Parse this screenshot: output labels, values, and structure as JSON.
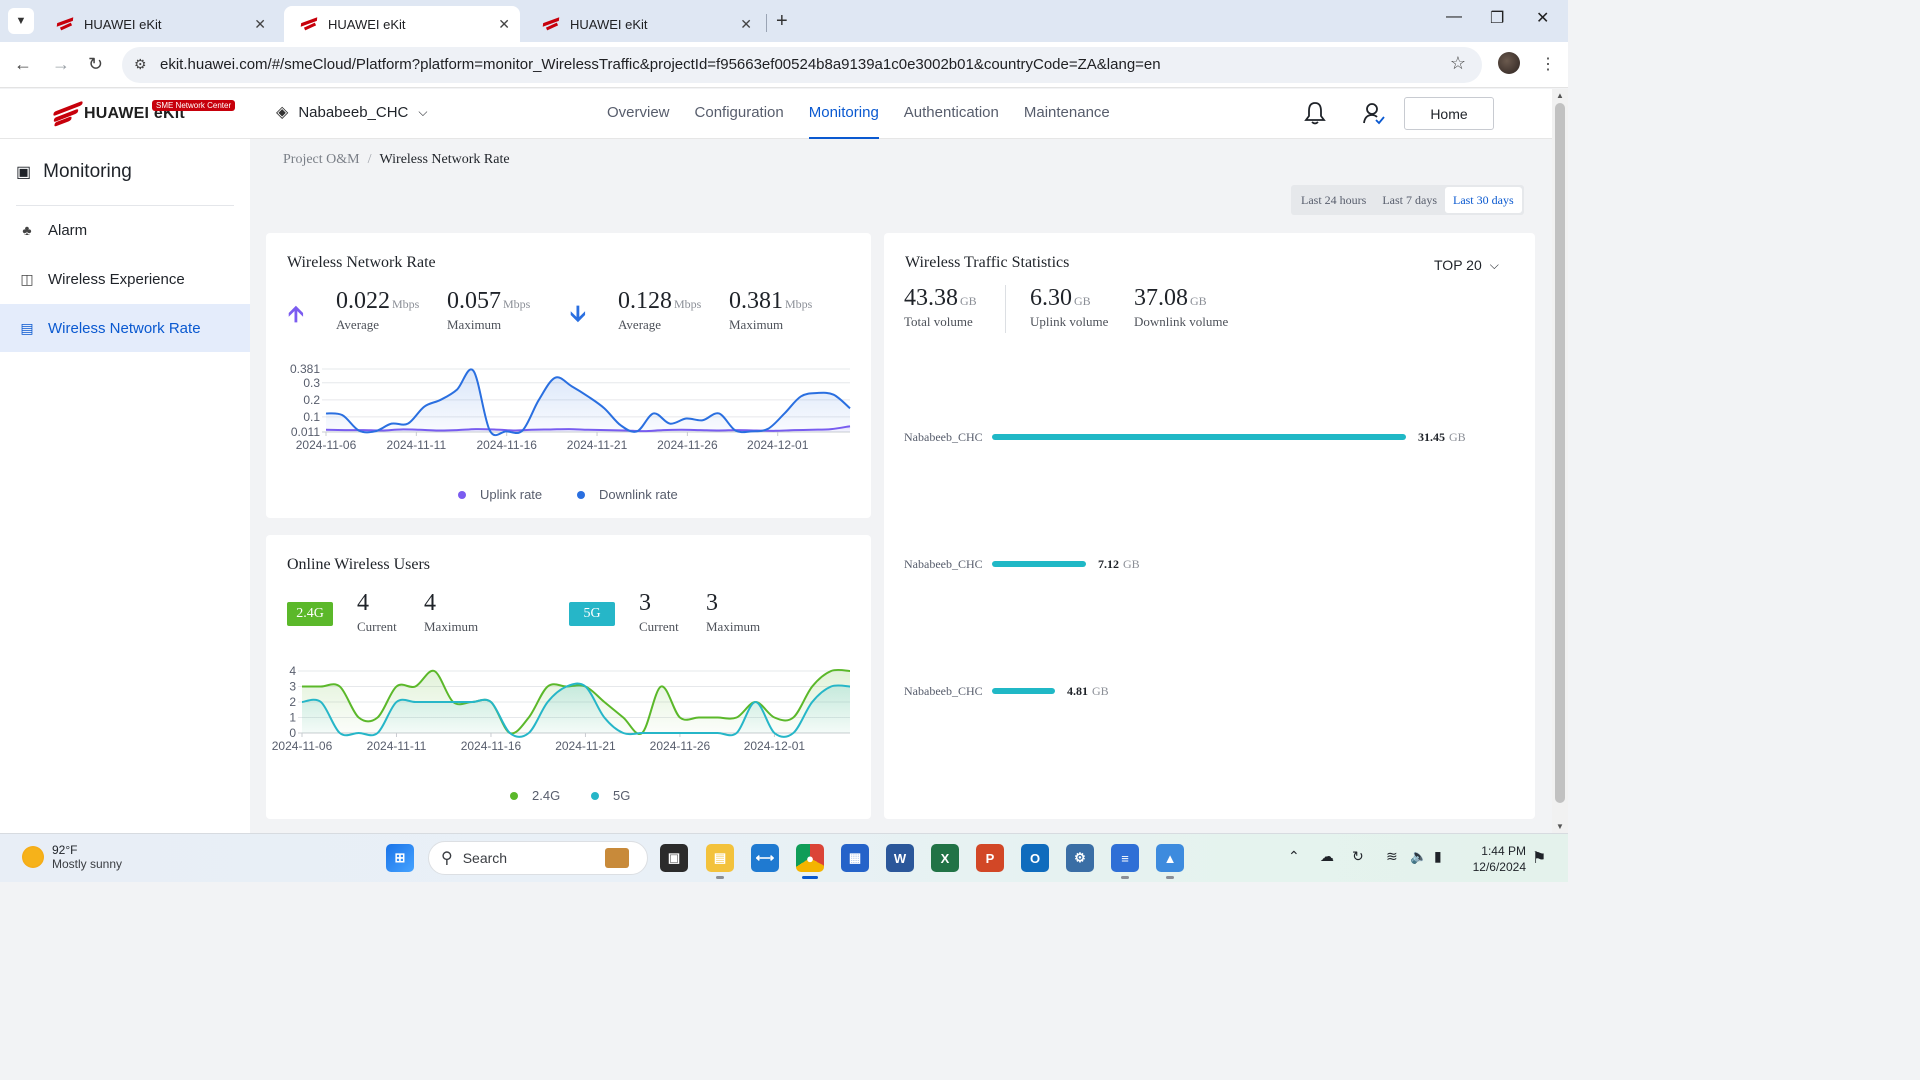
{
  "browser": {
    "tabs": [
      {
        "title": "HUAWEI eKit",
        "active": false
      },
      {
        "title": "HUAWEI eKit",
        "active": true
      },
      {
        "title": "HUAWEI eKit",
        "active": false
      }
    ],
    "url": "ekit.huawei.com/#/smeCloud/Platform?platform=monitor_WirelessTraffic&projectId=f95663ef00524b8a9139a1c0e3002b01&countryCode=ZA&lang=en"
  },
  "header": {
    "brand": "HUAWEI eKit",
    "badge": "SME Network Center",
    "project": "Nababeeb_CHC",
    "nav": [
      "Overview",
      "Configuration",
      "Monitoring",
      "Authentication",
      "Maintenance"
    ],
    "active_nav": "Monitoring",
    "home_label": "Home"
  },
  "sidebar": {
    "title": "Monitoring",
    "items": [
      {
        "label": "Alarm",
        "icon": "bell-icon",
        "active": false
      },
      {
        "label": "Wireless Experience",
        "icon": "monitor-wifi-icon",
        "active": false
      },
      {
        "label": "Wireless Network Rate",
        "icon": "chart-icon",
        "active": true
      }
    ]
  },
  "breadcrumb": {
    "parent": "Project O&M",
    "current": "Wireless Network Rate"
  },
  "time_range": {
    "options": [
      "Last 24 hours",
      "Last 7 days",
      "Last 30 days"
    ],
    "selected": "Last 30 days"
  },
  "rate_card": {
    "title": "Wireless Network Rate",
    "uplink": {
      "average": "0.022",
      "maximum": "0.057"
    },
    "downlink": {
      "average": "0.128",
      "maximum": "0.381"
    },
    "unit": "Mbps",
    "average_label": "Average",
    "maximum_label": "Maximum"
  },
  "users_card": {
    "title": "Online Wireless Users",
    "band24": {
      "tag": "2.4G",
      "current": "4",
      "maximum": "4"
    },
    "band5": {
      "tag": "5G",
      "current": "3",
      "maximum": "3"
    },
    "current_label": "Current",
    "maximum_label": "Maximum"
  },
  "traffic_card": {
    "title": "Wireless Traffic Statistics",
    "top_select": "TOP 20",
    "total": {
      "value": "43.38",
      "unit": "GB",
      "label": "Total volume"
    },
    "uplink": {
      "value": "6.30",
      "unit": "GB",
      "label": "Uplink volume"
    },
    "downlink": {
      "value": "37.08",
      "unit": "GB",
      "label": "Downlink volume"
    },
    "rows": [
      {
        "name": "Nababeeb_CHC",
        "value": 31.45,
        "value_text": "31.45",
        "unit": "GB"
      },
      {
        "name": "Nababeeb_CHC",
        "value": 7.12,
        "value_text": "7.12",
        "unit": "GB"
      },
      {
        "name": "Nababeeb_CHC",
        "value": 4.81,
        "value_text": "4.81",
        "unit": "GB"
      }
    ]
  },
  "colors": {
    "primary": "#0a59d0",
    "uplink": "#7b5cf0",
    "downlink": "#2a6fe0",
    "band24": "#5bb82a",
    "band5": "#26b6c8",
    "traffic_bar": "#20b8c6"
  },
  "chart_data": [
    {
      "type": "line",
      "title": "Wireless Network Rate",
      "ytick_labels": [
        "0.011",
        "0.1",
        "0.2",
        "0.3",
        "0.381"
      ],
      "yticks": [
        0.011,
        0.1,
        0.2,
        0.3,
        0.381
      ],
      "ylim": [
        0.011,
        0.381
      ],
      "x_tick_labels": [
        "2024-11-06",
        "2024-11-11",
        "2024-11-16",
        "2024-11-21",
        "2024-11-26",
        "2024-12-01"
      ],
      "x_tick_index": [
        0,
        5,
        10,
        15,
        20,
        25
      ],
      "series": [
        {
          "name": "Uplink rate",
          "color": "#7b5cf0",
          "values": [
            0.024,
            0.022,
            0.022,
            0.02,
            0.026,
            0.024,
            0.02,
            0.022,
            0.028,
            0.026,
            0.02,
            0.024,
            0.026,
            0.028,
            0.024,
            0.022,
            0.02,
            0.016,
            0.022,
            0.024,
            0.022,
            0.02,
            0.022,
            0.02,
            0.018,
            0.022,
            0.024,
            0.028,
            0.045
          ]
        },
        {
          "name": "Downlink rate",
          "color": "#2a6fe0",
          "values": [
            0.12,
            0.11,
            0.02,
            0.015,
            0.06,
            0.06,
            0.16,
            0.2,
            0.26,
            0.371,
            0.02,
            0.015,
            0.02,
            0.2,
            0.33,
            0.28,
            0.22,
            0.15,
            0.05,
            0.015,
            0.12,
            0.06,
            0.09,
            0.08,
            0.12,
            0.02,
            0.015,
            0.03,
            0.12,
            0.22,
            0.24,
            0.23,
            0.15
          ]
        }
      ],
      "legend": "bottom"
    },
    {
      "type": "line",
      "title": "Online Wireless Users",
      "yticks": [
        0,
        1,
        2,
        3,
        4
      ],
      "ylim": [
        0,
        4
      ],
      "x_tick_labels": [
        "2024-11-06",
        "2024-11-11",
        "2024-11-16",
        "2024-11-21",
        "2024-11-26",
        "2024-12-01"
      ],
      "x_tick_index": [
        0,
        5,
        10,
        15,
        20,
        25
      ],
      "series": [
        {
          "name": "2.4G",
          "color": "#5bb82a",
          "values": [
            3,
            3,
            3,
            1,
            1,
            3,
            3,
            4,
            2,
            2,
            2,
            0,
            1,
            3,
            3,
            3,
            2,
            1,
            0,
            3,
            1,
            1,
            1,
            1,
            2,
            1,
            1,
            3,
            4,
            4
          ]
        },
        {
          "name": "5G",
          "color": "#26b6c8",
          "values": [
            2,
            2,
            0,
            0,
            0,
            2,
            2,
            2,
            2,
            2,
            2,
            0,
            0,
            2,
            3,
            3,
            1,
            0,
            0,
            0,
            0,
            0,
            0,
            0,
            2,
            0,
            0,
            2,
            3,
            3
          ]
        }
      ],
      "legend": "bottom"
    },
    {
      "type": "bar",
      "title": "Wireless Traffic Statistics",
      "orientation": "horizontal",
      "categories": [
        "Nababeeb_CHC",
        "Nababeeb_CHC",
        "Nababeeb_CHC"
      ],
      "values": [
        31.45,
        7.12,
        4.81
      ],
      "unit": "GB"
    }
  ],
  "taskbar": {
    "weather_temp": "92°F",
    "weather_desc": "Mostly sunny",
    "search_placeholder": "Search",
    "time": "1:44 PM",
    "date": "12/6/2024"
  }
}
